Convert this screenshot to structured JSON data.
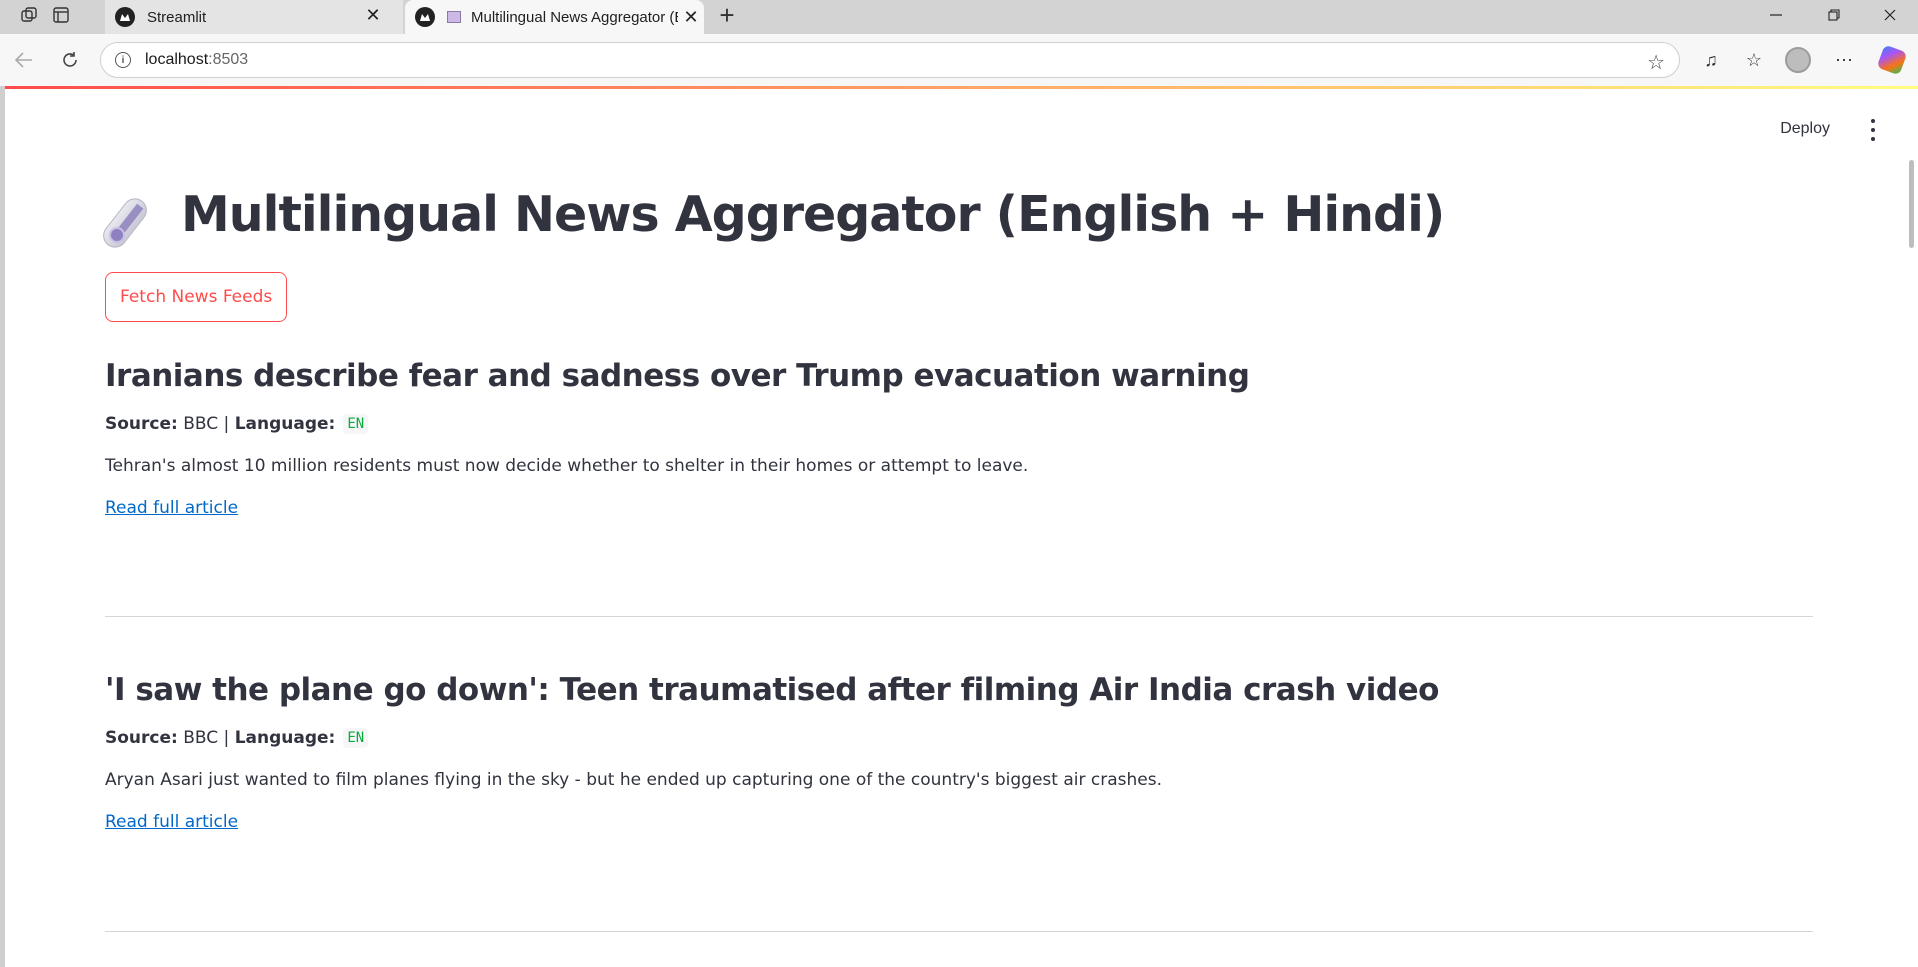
{
  "browser": {
    "tabs": [
      {
        "label": "Streamlit",
        "active": false
      },
      {
        "label": "Multilingual News Aggregator (English + Hindi)",
        "active": true
      }
    ],
    "url_host": "localhost",
    "url_port": ":8503"
  },
  "app": {
    "deploy_label": "Deploy",
    "title": "Multilingual News Aggregator (English + Hindi)",
    "title_icon": "rolled-newspaper-icon",
    "fetch_button": "Fetch News Feeds",
    "accent_color": "#ff4b4b",
    "link_color": "#0068c9",
    "source_label": "Source:",
    "language_label": "Language:",
    "articles": [
      {
        "headline": "Iranians describe fear and sadness over Trump evacuation warning",
        "source": "BBC",
        "language": "EN",
        "summary": "Tehran's almost 10 million residents must now decide whether to shelter in their homes or attempt to leave.",
        "link_text": "Read full article"
      },
      {
        "headline": "'I saw the plane go down': Teen traumatised after filming Air India crash video",
        "source": "BBC",
        "language": "EN",
        "summary": "Aryan Asari just wanted to film planes flying in the sky - but he ended up capturing one of the country's biggest air crashes.",
        "link_text": "Read full article"
      }
    ]
  }
}
